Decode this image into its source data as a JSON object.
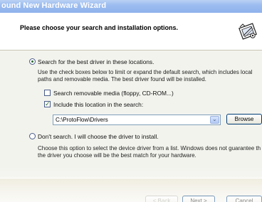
{
  "window": {
    "title": "ound New Hardware Wizard"
  },
  "header": {
    "title": "Please choose your search and installation options.",
    "icon": "hardware-wizard-icon"
  },
  "options": {
    "search": {
      "label": "Search for the best driver in these locations.",
      "selected": true,
      "description_line1": "Use the check boxes below to limit or expand the default search, which includes local",
      "description_line2": "paths and removable media. The best driver found will be installed."
    },
    "removable_media": {
      "label": "Search removable media (floppy, CD-ROM...)",
      "checked": false
    },
    "include_location": {
      "label": "Include this location in the search:",
      "checked": true
    },
    "location_path": {
      "value": "C:\\ProtoFlow\\Drivers"
    },
    "browse_label": "Browse",
    "dont_search": {
      "label": "Don't search. I will choose the driver to install.",
      "selected": false,
      "description_line1": "Choose this option to select the device driver from a list.  Windows does not guarantee th",
      "description_line2": "the driver you choose will be the best match for your hardware."
    }
  },
  "footer": {
    "back_label": "< Back",
    "next_label": "Next >",
    "cancel_label": "Cancel"
  },
  "colors": {
    "title_bar": "#9cbcf0",
    "radio_check_accent": "#2b6a2b",
    "button_border": "#003c74"
  }
}
